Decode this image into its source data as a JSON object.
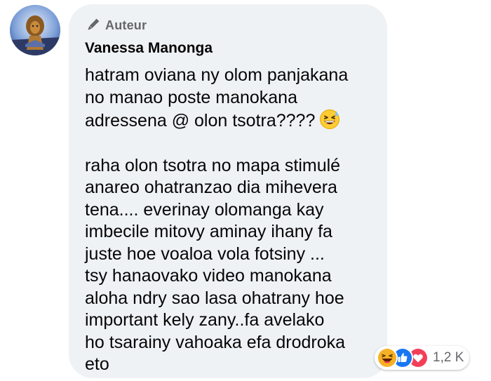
{
  "comment": {
    "badge": {
      "icon": "pen-icon",
      "label": "Auteur"
    },
    "author": "Vanessa Manonga",
    "paragraphs": [
      "hatram oviana ny olom panjakana\nno manao poste manokana\nadressena @ olon tsotra????",
      "raha olon tsotra no mapa stimulé\nanareo ohatranzao dia mihevera\ntena.... everinay olomanga kay\nimbecile mitovy aminay ihany fa\njuste hoe voaloa vola fotsiny ...\ntsy hanaovako video manokana\naloha ndry sao lasa ohatrany hoe\nimportant kely zany..fa avelako\nho tsarainy vahoaka efa drodroka\neto"
    ],
    "inline_emoji": "grinning-sweat-emoji"
  },
  "reactions": {
    "icons": [
      "haha-reaction-icon",
      "like-reaction-icon",
      "love-reaction-icon"
    ],
    "count": "1,2 K"
  },
  "colors": {
    "bubble_bg": "#eff2f5",
    "secondary_text": "#65676b",
    "like_blue": "#1877f2",
    "love_red": "#f33e58",
    "haha_yellow": "#f7b125"
  }
}
